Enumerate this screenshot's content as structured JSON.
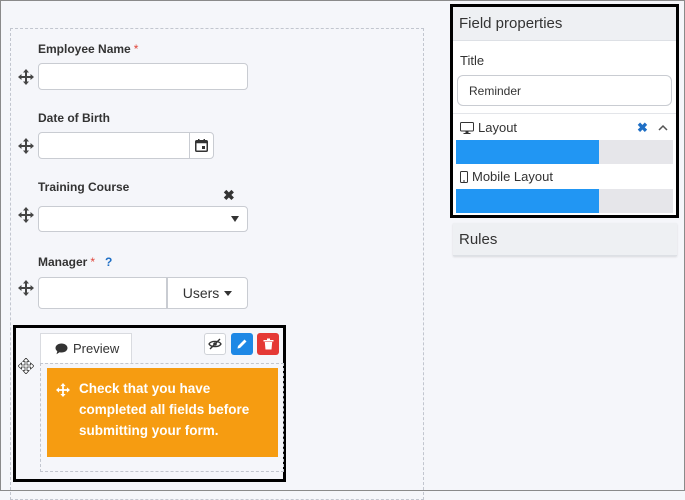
{
  "form": {
    "employee_name": {
      "label": "Employee Name",
      "required_mark": "*",
      "value": ""
    },
    "date_of_birth": {
      "label": "Date of Birth",
      "value": ""
    },
    "training_course": {
      "label": "Training Course",
      "selected": "",
      "clear_glyph": "✖"
    },
    "manager": {
      "label": "Manager",
      "required_mark": "*",
      "help_glyph": "?",
      "value": "",
      "picker_label": "Users"
    }
  },
  "notice_block": {
    "preview_label": "Preview",
    "text": "Check that you have completed all fields before submitting your form.",
    "background": "#f69c11"
  },
  "properties_panel": {
    "heading": "Field properties",
    "title_label": "Title",
    "title_value": "Reminder",
    "layout_label": "Layout",
    "layout_fill": 0.66,
    "mobile_layout_label": "Mobile Layout",
    "mobile_layout_fill": 0.66,
    "bar_color": "#2196f3"
  },
  "rules_panel": {
    "heading": "Rules"
  }
}
